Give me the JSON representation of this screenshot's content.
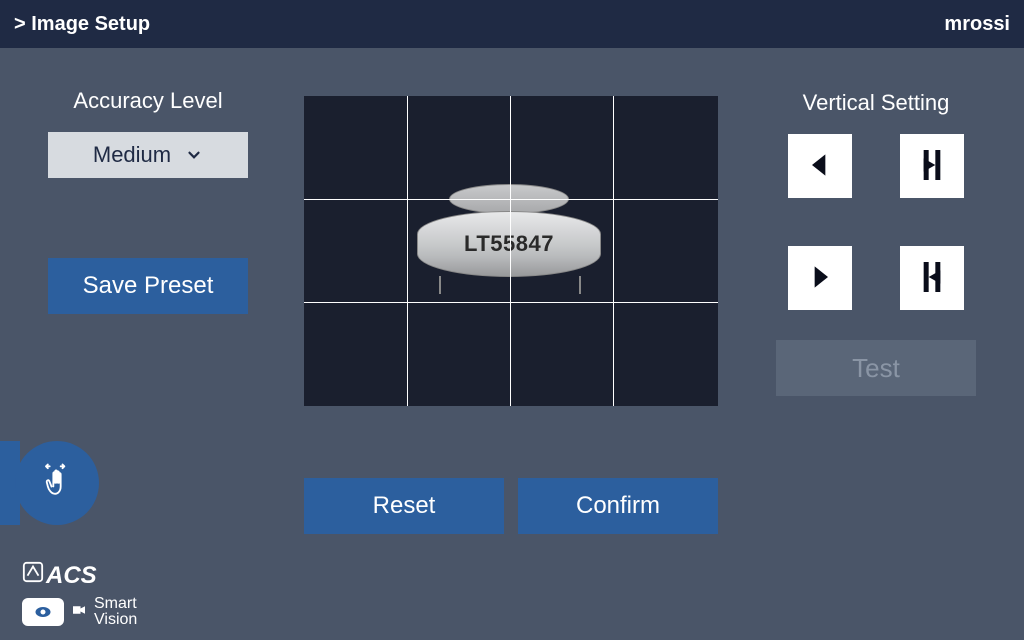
{
  "header": {
    "title": "> Image Setup",
    "user": "mrossi"
  },
  "left": {
    "accuracy_label": "Accuracy Level",
    "dropdown_value": "Medium",
    "save_label": "Save Preset"
  },
  "preview": {
    "component_text": "LT55847"
  },
  "right": {
    "vertical_label": "Vertical Setting",
    "test_label": "Test",
    "buttons": {
      "prev": "arrow-left",
      "step_prev": "step-left",
      "next": "arrow-right",
      "step_next": "step-right"
    }
  },
  "bottom": {
    "reset_label": "Reset",
    "confirm_label": "Confirm"
  },
  "branding": {
    "logo1": "ACS",
    "logo2_line1": "Smart",
    "logo2_line2": "Vision"
  }
}
